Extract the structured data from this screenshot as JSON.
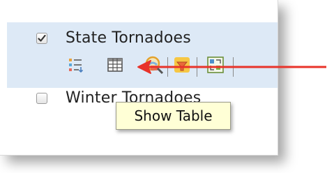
{
  "layers": [
    {
      "label": "State Tornadoes",
      "checked": true,
      "selected": true
    },
    {
      "label": "Winter Tornadoes",
      "checked": false,
      "selected": false
    }
  ],
  "toolbar": {
    "icons": [
      "legend-icon",
      "table-icon",
      "zoom-to-icon",
      "filter-icon",
      "style-icon"
    ]
  },
  "tooltip": {
    "text": "Show Table"
  },
  "colors": {
    "selection": "#dde9f6",
    "tooltip_bg": "#ffffd6",
    "arrow": "#e8332a"
  }
}
